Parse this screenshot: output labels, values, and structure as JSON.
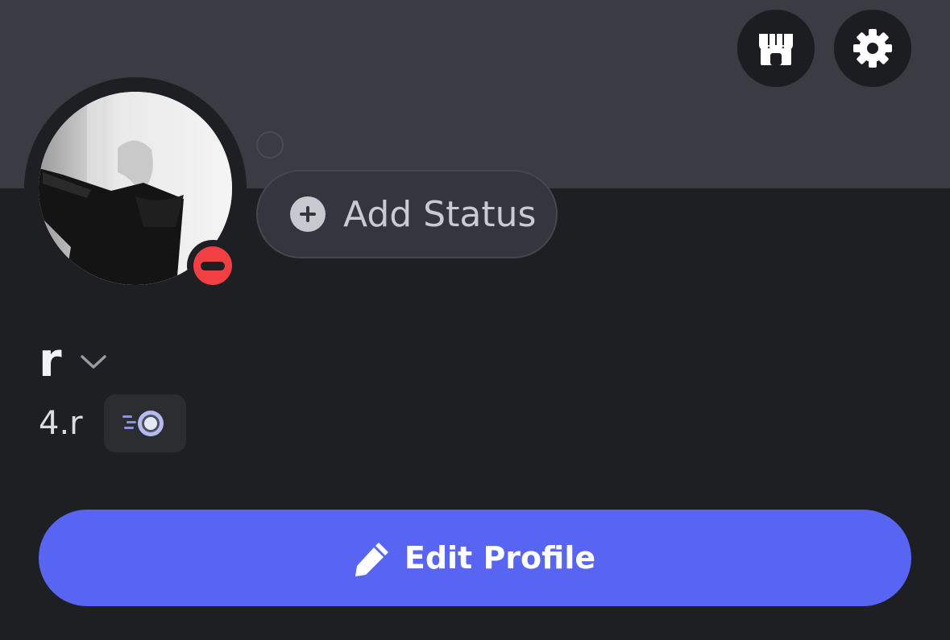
{
  "profile": {
    "display_name": "r",
    "handle": "4.r",
    "status_indicator": "do-not-disturb",
    "status_color": "#f23f43",
    "badge_icon": "nitro-boost-icon"
  },
  "status_bubble": {
    "label": "Add Status",
    "icon": "plus-circle-icon"
  },
  "header": {
    "shop_icon": "shop-icon",
    "settings_icon": "gear-icon"
  },
  "actions": {
    "edit_profile_label": "Edit Profile",
    "edit_icon": "pencil-icon"
  },
  "colors": {
    "banner": "#3a3b43",
    "background": "#1e1f22",
    "accent": "#5865f2"
  }
}
